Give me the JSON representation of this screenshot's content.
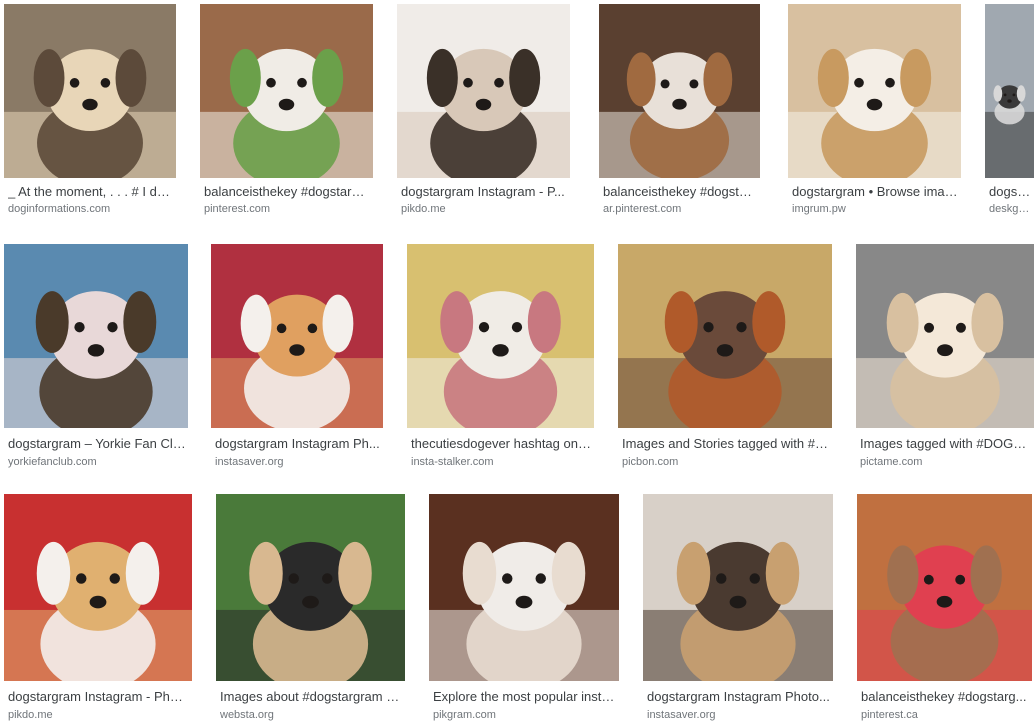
{
  "rows": [
    {
      "items": [
        {
          "title": "_ At the moment, . . . # I dw...",
          "site": "doginformations.com",
          "palette": [
            "#8a7a66",
            "#e8d6b8",
            "#5c4a3a"
          ],
          "icon": "pug-in-basket"
        },
        {
          "title": "balanceisthekey #dogstargr...",
          "site": "pinterest.com",
          "palette": [
            "#9a6a4a",
            "#f0ece6",
            "#6ba04a"
          ],
          "icon": "beagle-with-duck-toy"
        },
        {
          "title": "dogstargram Instagram - P...",
          "site": "pikdo.me",
          "palette": [
            "#f0ece8",
            "#d8c8b8",
            "#3a3028"
          ],
          "icon": "shih-tzu"
        },
        {
          "title": "balanceisthekey #dogstarg...",
          "site": "ar.pinterest.com",
          "palette": [
            "#5a4030",
            "#e8e0d8",
            "#a06a40"
          ],
          "icon": "sleeping-beagles"
        },
        {
          "title": "dogstargram • Browse imag...",
          "site": "imgrum.pw",
          "palette": [
            "#d8c0a0",
            "#f4eee6",
            "#c89a60"
          ],
          "icon": "puppy-with-bowl"
        },
        {
          "title": "dogstarg...",
          "site": "deskgram",
          "palette": [
            "#a0a8b0",
            "#3a3a3a",
            "#d8d8d8"
          ],
          "icon": "dog-partial"
        }
      ]
    },
    {
      "items": [
        {
          "title": "dogstargram – Yorkie Fan Club",
          "site": "yorkiefanclub.com",
          "palette": [
            "#5a8ab0",
            "#e8d8d8",
            "#4a3a2a"
          ],
          "icon": "yorkie-on-chair"
        },
        {
          "title": "dogstargram Instagram Ph...",
          "site": "instasaver.org",
          "palette": [
            "#b03040",
            "#e0a060",
            "#f4f0ec"
          ],
          "icon": "corgi-lying"
        },
        {
          "title": "thecutiesdogever hashtag on I...",
          "site": "insta-stalker.com",
          "palette": [
            "#d8c070",
            "#f0ece6",
            "#c87880"
          ],
          "icon": "white-puppies-collage"
        },
        {
          "title": "Images and Stories tagged with #d...",
          "site": "picbon.com",
          "palette": [
            "#c8a868",
            "#6a4a3a",
            "#b05a2a"
          ],
          "icon": "two-dogs-sitting"
        },
        {
          "title": "Images tagged with #DOGS...",
          "site": "pictame.com",
          "palette": [
            "#888888",
            "#f4e8d8",
            "#d8c0a0"
          ],
          "icon": "fluffy-dog-sofa"
        }
      ]
    },
    {
      "items": [
        {
          "title": "dogstargram Instagram - Phot...",
          "site": "pikdo.me",
          "palette": [
            "#c83030",
            "#e0b070",
            "#f4f0ec"
          ],
          "icon": "golden-puppy-santa-hat"
        },
        {
          "title": "Images about #dogstargram o...",
          "site": "websta.org",
          "palette": [
            "#4a7a3a",
            "#2a2a2a",
            "#d8b890"
          ],
          "icon": "five-labradors"
        },
        {
          "title": "Explore the most popular insta...",
          "site": "pikgram.com",
          "palette": [
            "#5a3020",
            "#f0ece8",
            "#e8dcd0"
          ],
          "icon": "brown-dog-closeup"
        },
        {
          "title": "dogstargram Instagram Photo...",
          "site": "instasaver.org",
          "palette": [
            "#d8d0c8",
            "#4a3a30",
            "#c8a070"
          ],
          "icon": "yorkie-standing"
        },
        {
          "title": "balanceisthekey #dogstarg...",
          "site": "pinterest.ca",
          "palette": [
            "#c07040",
            "#e04050",
            "#a07050"
          ],
          "icon": "beagle-with-toy"
        }
      ]
    }
  ]
}
